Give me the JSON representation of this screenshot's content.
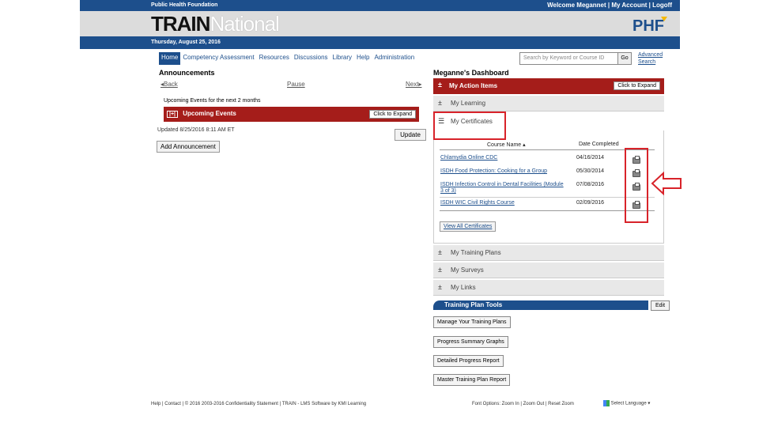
{
  "topbar": {
    "org": "Public Health Foundation",
    "welcome": "Welcome Megannet",
    "sep1": "|",
    "my_account": "My Account",
    "sep2": "|",
    "logoff": "Logoff"
  },
  "brand": {
    "logo_bold": "TRAIN",
    "logo_light": "National",
    "partner_logo": "PHF"
  },
  "datebar": {
    "date": "Thursday, August 25, 2016"
  },
  "nav": {
    "items": [
      "Home",
      "Competency Assessment",
      "Resources",
      "Discussions",
      "Library",
      "Help",
      "Administration"
    ],
    "active": "Home"
  },
  "search": {
    "placeholder": "Search by Keyword or Course ID",
    "go": "Go",
    "advanced": "Advanced Search"
  },
  "announcements": {
    "title": "Announcements",
    "back": "Back",
    "pause": "Pause",
    "next": "Next",
    "upcoming_label": "Upcoming Events for the next 2 months",
    "upcoming_bar": "Upcoming Events",
    "expand": "Click to Expand",
    "updated": "Updated 8/25/2016 8:11 AM ET",
    "update_btn": "Update",
    "add_btn": "Add Announcement"
  },
  "dashboard": {
    "title": "Meganne's Dashboard",
    "action_items": "My Action Items",
    "expand": "Click to Expand",
    "learning": "My Learning",
    "certificates": "My Certificates",
    "col_name": "Course Name",
    "col_date": "Date Completed",
    "certs": [
      {
        "name": "Chlamydia Online CDC",
        "date": "04/16/2014"
      },
      {
        "name": "ISDH Food Protection: Cooking for a Group",
        "date": "05/30/2014"
      },
      {
        "name": "ISDH Infection Control in Dental Facilities (Module 3 of 3)",
        "date": "07/08/2016"
      },
      {
        "name": "ISDH WIC Civil Rights Course",
        "date": "02/09/2016"
      }
    ],
    "view_all": "View All Certificates",
    "training_plans": "My Training Plans",
    "surveys": "My Surveys",
    "links": "My Links"
  },
  "tools": {
    "title": "Training Plan Tools",
    "edit": "Edit",
    "buttons": [
      "Manage Your Training Plans",
      "Progress Summary Graphs",
      "Detailed Progress Report",
      "Master Training Plan Report"
    ]
  },
  "footer": {
    "left": "Help | Contact | © 2016 2003-2016 Confidentiality Statement | TRAIN - LMS Software by KMI Learning",
    "right": "Font Options: Zoom In | Zoom Out | Reset Zoom",
    "lang": "Select Language"
  },
  "colors": {
    "navy": "#1d4f8c",
    "red": "#a51d1a",
    "highlight": "#d8232a"
  }
}
